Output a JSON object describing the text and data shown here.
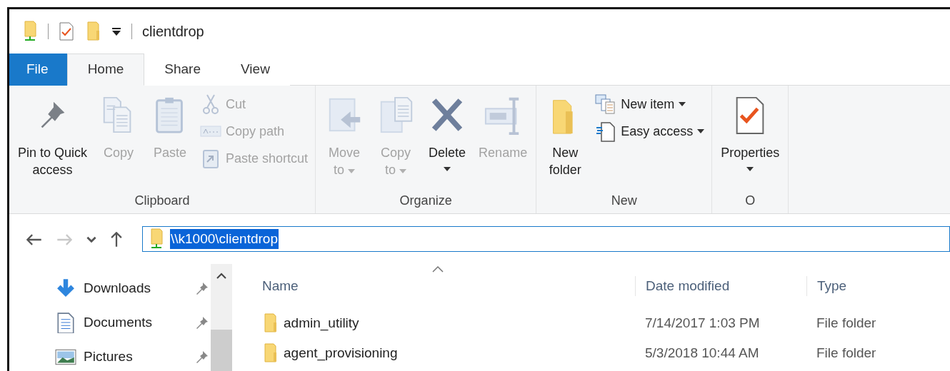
{
  "title_bar": {
    "title": "clientdrop"
  },
  "ribbon_tabs": [
    {
      "label": "File",
      "kind": "file",
      "selected": false
    },
    {
      "label": "Home",
      "kind": "tab",
      "selected": true
    },
    {
      "label": "Share",
      "kind": "tab",
      "selected": false
    },
    {
      "label": "View",
      "kind": "tab",
      "selected": false
    }
  ],
  "ribbon_groups": [
    {
      "label": "Clipboard",
      "items": [
        {
          "kind": "large",
          "label": "Pin to Quick\naccess",
          "disabled": false
        },
        {
          "kind": "large",
          "label": "Copy",
          "disabled": true
        },
        {
          "kind": "large",
          "label": "Paste",
          "disabled": true
        },
        {
          "kind": "small",
          "label": "Cut",
          "disabled": true
        },
        {
          "kind": "small",
          "label": "Copy path",
          "disabled": true
        },
        {
          "kind": "small",
          "label": "Paste shortcut",
          "disabled": true
        }
      ]
    },
    {
      "label": "Organize",
      "items": [
        {
          "kind": "large",
          "label": "Move\nto",
          "disabled": true,
          "dropdown": true
        },
        {
          "kind": "large",
          "label": "Copy\nto",
          "disabled": true,
          "dropdown": true
        },
        {
          "kind": "split",
          "label": "Delete",
          "disabled": false,
          "dropdown": true
        },
        {
          "kind": "large",
          "label": "Rename",
          "disabled": true
        }
      ]
    },
    {
      "label": "New",
      "items": [
        {
          "kind": "large",
          "label": "New\nfolder",
          "disabled": false
        },
        {
          "kind": "small",
          "label": "New item",
          "disabled": false,
          "dropdown": true
        },
        {
          "kind": "small",
          "label": "Easy access",
          "disabled": false,
          "dropdown": true
        }
      ]
    },
    {
      "label": "O",
      "items": [
        {
          "kind": "split",
          "label": "Properties",
          "disabled": false,
          "dropdown": true
        }
      ]
    }
  ],
  "nav_buttons": [
    {
      "disabled": false
    },
    {
      "disabled": true
    },
    {
      "disabled": false
    },
    {
      "disabled": false
    }
  ],
  "address": {
    "value": "\\\\k1000\\clientdrop",
    "selected": true
  },
  "sidebar": {
    "items": [
      {
        "label": "Downloads",
        "pinned": true
      },
      {
        "label": "Documents",
        "pinned": true
      },
      {
        "label": "Pictures",
        "pinned": true
      }
    ]
  },
  "file_list": {
    "columns": [
      {
        "label": "Name",
        "sorted": true
      },
      {
        "label": "Date modified"
      },
      {
        "label": "Type"
      }
    ],
    "rows": [
      {
        "name": "admin_utility",
        "date_modified": "7/14/2017 1:03 PM",
        "type": "File folder"
      },
      {
        "name": "agent_provisioning",
        "date_modified": "5/3/2018 10:44 AM",
        "type": "File folder"
      }
    ]
  }
}
